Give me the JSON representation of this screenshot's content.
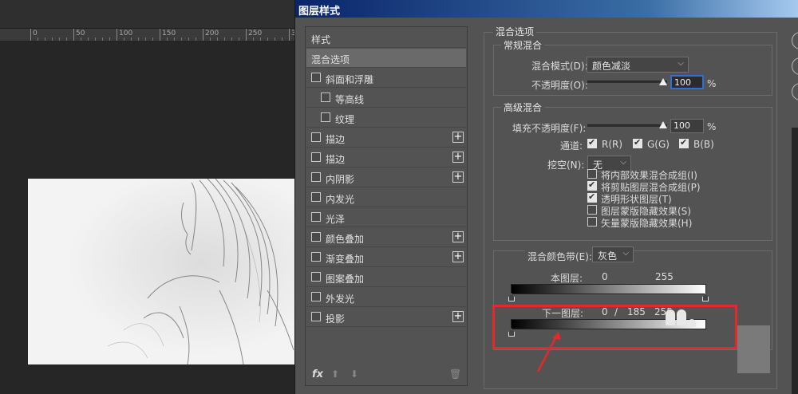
{
  "ruler": {
    "labels": [
      "0",
      "50",
      "100",
      "150",
      "200",
      "250",
      "30"
    ]
  },
  "dialog": {
    "title": "图层样式"
  },
  "styles_panel": {
    "header": "样式",
    "items": [
      {
        "label": "混合选项",
        "checkbox": false,
        "plus": false,
        "selected": true,
        "indent": 0
      },
      {
        "label": "斜面和浮雕",
        "checkbox": true,
        "checked": false,
        "plus": false,
        "indent": 0
      },
      {
        "label": "等高线",
        "checkbox": true,
        "checked": false,
        "plus": false,
        "indent": 1
      },
      {
        "label": "纹理",
        "checkbox": true,
        "checked": false,
        "plus": false,
        "indent": 1
      },
      {
        "label": "描边",
        "checkbox": true,
        "checked": false,
        "plus": true,
        "indent": 0
      },
      {
        "label": "描边",
        "checkbox": true,
        "checked": false,
        "plus": true,
        "indent": 0
      },
      {
        "label": "内阴影",
        "checkbox": true,
        "checked": false,
        "plus": true,
        "indent": 0
      },
      {
        "label": "内发光",
        "checkbox": true,
        "checked": false,
        "plus": false,
        "indent": 0
      },
      {
        "label": "光泽",
        "checkbox": true,
        "checked": false,
        "plus": false,
        "indent": 0
      },
      {
        "label": "颜色叠加",
        "checkbox": true,
        "checked": false,
        "plus": true,
        "indent": 0
      },
      {
        "label": "渐变叠加",
        "checkbox": true,
        "checked": false,
        "plus": true,
        "indent": 0
      },
      {
        "label": "图案叠加",
        "checkbox": true,
        "checked": false,
        "plus": false,
        "indent": 0
      },
      {
        "label": "外发光",
        "checkbox": true,
        "checked": false,
        "plus": false,
        "indent": 0
      },
      {
        "label": "投影",
        "checkbox": true,
        "checked": false,
        "plus": true,
        "indent": 0
      }
    ],
    "fx_label": "fx",
    "icons": [
      "fx-icon",
      "move-up-icon",
      "move-down-icon",
      "trash-icon"
    ]
  },
  "blending": {
    "section_title": "混合选项",
    "general": {
      "title": "常规混合",
      "mode_label": "混合模式(D):",
      "mode_value": "颜色减淡",
      "opacity_label": "不透明度(O):",
      "opacity_value": "100",
      "opacity_unit": "%"
    },
    "advanced": {
      "title": "高级混合",
      "fill_label": "填充不透明度(F):",
      "fill_value": "100",
      "fill_unit": "%",
      "channels_label": "通道:",
      "channels": [
        {
          "label": "R(R)",
          "checked": true
        },
        {
          "label": "G(G)",
          "checked": true
        },
        {
          "label": "B(B)",
          "checked": true
        }
      ],
      "knockout_label": "挖空(N):",
      "knockout_value": "无",
      "options": [
        {
          "label": "将内部效果混合成组(I)",
          "checked": false
        },
        {
          "label": "将剪贴图层混合成组(P)",
          "checked": true
        },
        {
          "label": "透明形状图层(T)",
          "checked": true
        },
        {
          "label": "图层蒙版隐藏效果(S)",
          "checked": false
        },
        {
          "label": "矢量蒙版隐藏效果(H)",
          "checked": false
        }
      ]
    },
    "blend_if": {
      "label": "混合颜色带(E):",
      "value": "灰色",
      "this_layer_label": "本图层:",
      "this_layer_low": "0",
      "this_layer_high": "255",
      "underlying_label": "下一图层:",
      "underlying_low": "0",
      "underlying_sep": "/",
      "underlying_mid": "185",
      "underlying_high": "255"
    }
  },
  "colors": {
    "highlight_red": "#e22a2a",
    "active_blue": "#2c6fd6",
    "title_blue": "#0a246a"
  }
}
